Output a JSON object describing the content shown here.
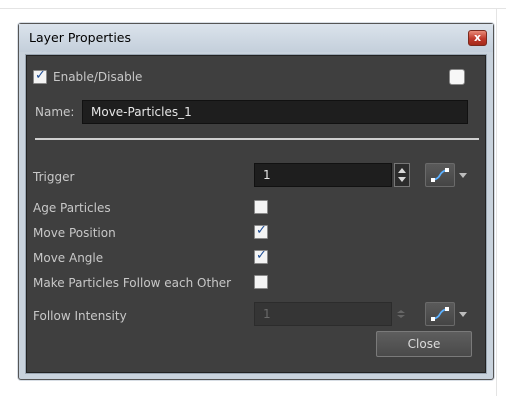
{
  "window": {
    "title": "Layer Properties",
    "close_glyph": "x"
  },
  "enable": {
    "label": "Enable/Disable",
    "checked": true
  },
  "name": {
    "label": "Name:",
    "value": "Move-Particles_1"
  },
  "trigger": {
    "label": "Trigger",
    "value": "1"
  },
  "options": [
    {
      "label": "Age Particles",
      "checked": false
    },
    {
      "label": "Move Position",
      "checked": true
    },
    {
      "label": "Move Angle",
      "checked": true
    },
    {
      "label": "Make Particles Follow each Other",
      "checked": false
    }
  ],
  "follow_intensity": {
    "label": "Follow Intensity",
    "value": "1",
    "disabled": true
  },
  "buttons": {
    "close_label": "Close"
  },
  "icons": {
    "function": "function-curve-icon",
    "dropdown": "chevron-down-icon",
    "spinner": "spinner-arrows-icon"
  },
  "colors": {
    "panel_bg": "#3f3f3f",
    "field_bg": "#1e1e1e",
    "frame": "#c9d3dd",
    "close_red": "#c0392b",
    "checkmark": "#1f4e96"
  }
}
